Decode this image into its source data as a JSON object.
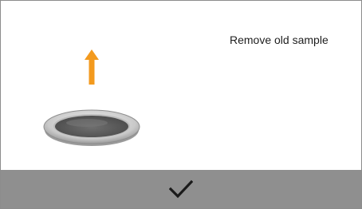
{
  "screen": {
    "instruction": "Remove old sample"
  },
  "icons": {
    "arrow": "arrow-up-icon",
    "dish": "sample-dish-icon",
    "check": "checkmark-icon"
  },
  "colors": {
    "arrow": "#f39a1e",
    "confirm_bar": "#8f8f8f",
    "check": "#1a1a1a",
    "dish_rim": "#a9a9a9",
    "sample": "#5e5e5e"
  }
}
